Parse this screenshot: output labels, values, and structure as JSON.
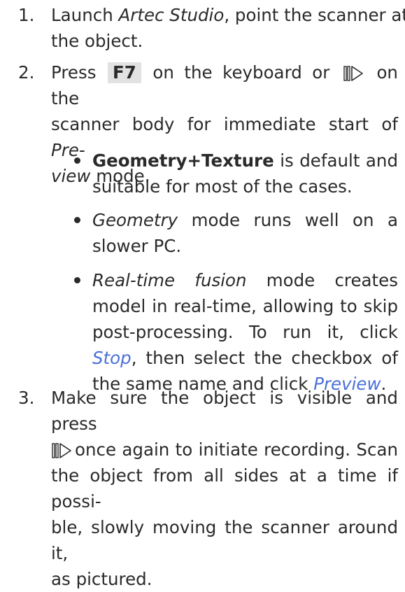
{
  "steps": [
    {
      "number": "1.",
      "text_a": "Launch ",
      "app_name": "Artec Studio",
      "text_b": ", point the scanner at",
      "text_c": "the object."
    },
    {
      "number": "2.",
      "text_a": "Press",
      "key": "F7",
      "text_b": "on the keyboard or",
      "text_c": "on the",
      "text_d": "scanner body for immediate start of ",
      "mode_a": "Pre-",
      "mode_b": "view",
      "text_e": " mode."
    },
    {
      "number": "3.",
      "text_a": "Make sure the object is visible and press",
      "text_b": "once again to initiate recording. Scan",
      "text_c": "the object from all sides at a time if possi-",
      "text_d": "ble, slowly moving the scanner around it,",
      "text_e": "as pictured."
    }
  ],
  "bullets": [
    {
      "bold": "Geometry+Texture",
      "text_a": " is default and",
      "text_b": "suitable for most of the cases."
    },
    {
      "italic": "Geometry",
      "text_a": " mode runs well on a",
      "text_b": "slower PC."
    },
    {
      "italic": "Real-time fusion",
      "text_a": " mode creates",
      "text_b": "model in real-time, allowing to skip",
      "text_c": "post-processing.  To run it, click",
      "link_a": "Stop",
      "text_d": ", then select the checkbox of",
      "text_e": "the same name and click ",
      "link_b": "Preview",
      "text_f": "."
    }
  ],
  "icons": {
    "scan_button": "scanner-start-icon"
  },
  "colors": {
    "text": "#2a2a2a",
    "link": "#4a6fd8",
    "key_bg": "#e2e2e2"
  }
}
